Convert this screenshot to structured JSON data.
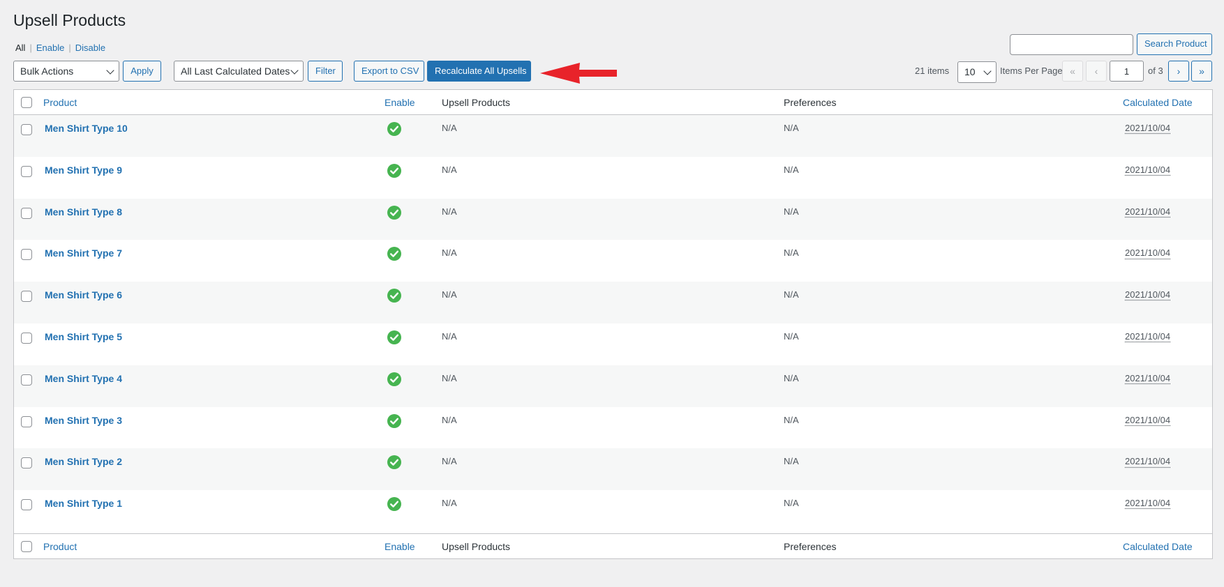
{
  "page": {
    "title": "Upsell Products"
  },
  "filters": {
    "all": "All",
    "enable": "Enable",
    "disable": "Disable"
  },
  "toolbar": {
    "bulk_actions": "Bulk Actions",
    "apply": "Apply",
    "date_filter": "All Last Calculated Dates",
    "filter": "Filter",
    "export_csv": "Export to CSV",
    "recalculate": "Recalculate All Upsells"
  },
  "search": {
    "value": "",
    "button": "Search Product"
  },
  "pagination": {
    "items_count": "21 items",
    "per_page_value": "10",
    "per_page_label": "Items Per Page",
    "first": "«",
    "prev": "‹",
    "current_page": "1",
    "of_pages": "of 3",
    "next": "›",
    "last": "»"
  },
  "table": {
    "columns": {
      "product": "Product",
      "enable": "Enable",
      "upsell_products": "Upsell Products",
      "preferences": "Preferences",
      "calculated_date": "Calculated Date"
    },
    "rows": [
      {
        "product": "Men Shirt Type 10",
        "enabled": true,
        "upsell": "N/A",
        "preferences": "N/A",
        "date": "2021/10/04"
      },
      {
        "product": "Men Shirt Type 9",
        "enabled": true,
        "upsell": "N/A",
        "preferences": "N/A",
        "date": "2021/10/04"
      },
      {
        "product": "Men Shirt Type 8",
        "enabled": true,
        "upsell": "N/A",
        "preferences": "N/A",
        "date": "2021/10/04"
      },
      {
        "product": "Men Shirt Type 7",
        "enabled": true,
        "upsell": "N/A",
        "preferences": "N/A",
        "date": "2021/10/04"
      },
      {
        "product": "Men Shirt Type 6",
        "enabled": true,
        "upsell": "N/A",
        "preferences": "N/A",
        "date": "2021/10/04"
      },
      {
        "product": "Men Shirt Type 5",
        "enabled": true,
        "upsell": "N/A",
        "preferences": "N/A",
        "date": "2021/10/04"
      },
      {
        "product": "Men Shirt Type 4",
        "enabled": true,
        "upsell": "N/A",
        "preferences": "N/A",
        "date": "2021/10/04"
      },
      {
        "product": "Men Shirt Type 3",
        "enabled": true,
        "upsell": "N/A",
        "preferences": "N/A",
        "date": "2021/10/04"
      },
      {
        "product": "Men Shirt Type 2",
        "enabled": true,
        "upsell": "N/A",
        "preferences": "N/A",
        "date": "2021/10/04"
      },
      {
        "product": "Men Shirt Type 1",
        "enabled": true,
        "upsell": "N/A",
        "preferences": "N/A",
        "date": "2021/10/04"
      }
    ]
  },
  "colors": {
    "accent": "#2271b1",
    "success": "#46b450",
    "annotation_arrow": "#e8232a"
  },
  "icons": {
    "enabled": "check-circle-icon",
    "annotation": "red-arrow-icon"
  }
}
